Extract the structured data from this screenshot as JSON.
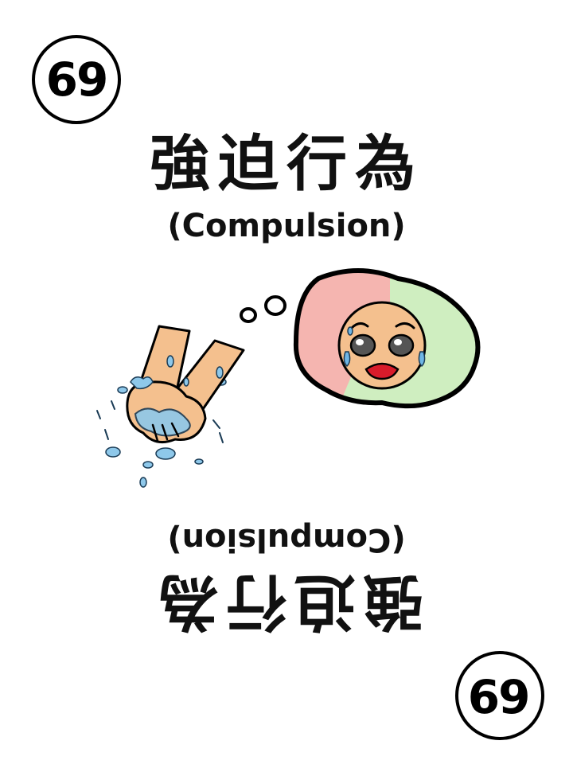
{
  "card": {
    "number": "69",
    "title_cn": "強迫行為",
    "title_en": "(Compulsion)"
  },
  "illustration": {
    "hands": "hand-washing-hands",
    "thought": "worried-crying-face",
    "colors": {
      "skin": "#f4c08e",
      "water": "#8ec8ea",
      "bubble_left": "#f5b5b0",
      "bubble_right": "#cfeec0",
      "tears": "#6fb6e6",
      "mouth": "#d81b2b"
    }
  }
}
